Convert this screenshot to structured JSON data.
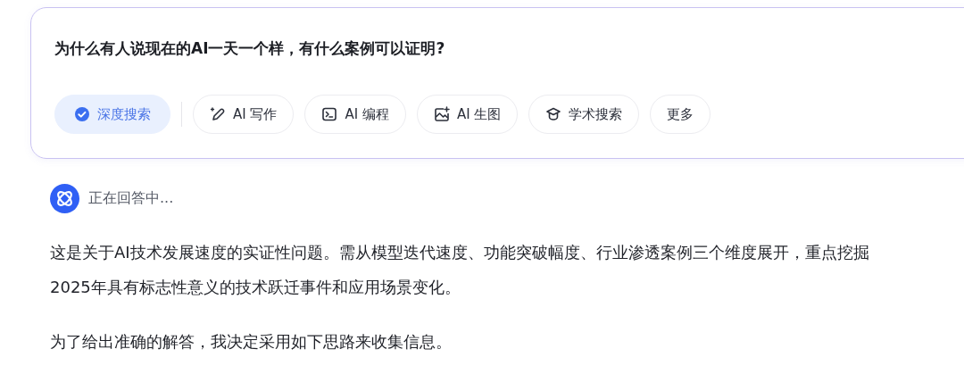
{
  "query": {
    "text": "为什么有人说现在的AI一天一个样，有什么案例可以证明?"
  },
  "tools": [
    {
      "kind": "deep",
      "label": "深度搜索",
      "selected": true
    },
    {
      "kind": "write",
      "label": "AI 写作",
      "selected": false
    },
    {
      "kind": "code",
      "label": "AI 编程",
      "selected": false
    },
    {
      "kind": "image",
      "label": "AI 生图",
      "selected": false
    },
    {
      "kind": "academic",
      "label": "学术搜索",
      "selected": false
    },
    {
      "kind": "more",
      "label": "更多",
      "selected": false
    }
  ],
  "status": {
    "text": "正在回答中..."
  },
  "paragraphs": [
    "这是关于AI技术发展速度的实证性问题。需从模型迭代速度、功能突破幅度、行业渗透案例三个维度展开，重点挖掘2025年具有标志性意义的技术跃迁事件和应用场景变化。",
    "为了给出准确的解答，我决定采用如下思路来收集信息。"
  ]
}
